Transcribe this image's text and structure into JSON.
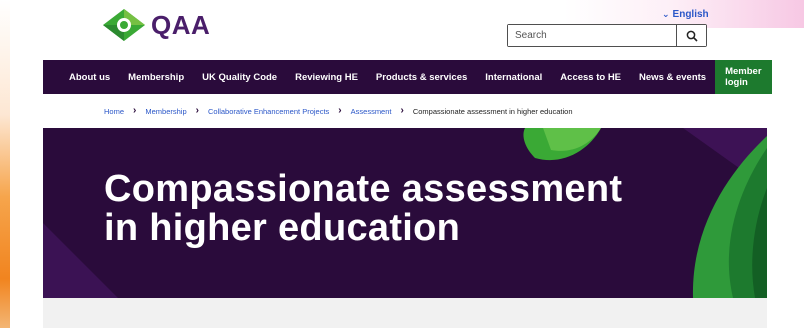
{
  "logo": {
    "text": "QAA"
  },
  "language": {
    "label": "English"
  },
  "search": {
    "placeholder": "Search"
  },
  "nav": {
    "items": [
      "About us",
      "Membership",
      "UK Quality Code",
      "Reviewing HE",
      "Products & services",
      "International",
      "Access to HE",
      "News & events"
    ],
    "login": "Member login"
  },
  "breadcrumb": {
    "items": [
      "Home",
      "Membership",
      "Collaborative Enhancement Projects",
      "Assessment"
    ],
    "current": "Compassionate assessment in higher education"
  },
  "hero": {
    "title_line1": "Compassionate assessment",
    "title_line2": "in higher education"
  },
  "colors": {
    "brand_purple": "#2a0b3b",
    "brand_green": "#1d7a2e",
    "link_blue": "#2b57c8"
  }
}
